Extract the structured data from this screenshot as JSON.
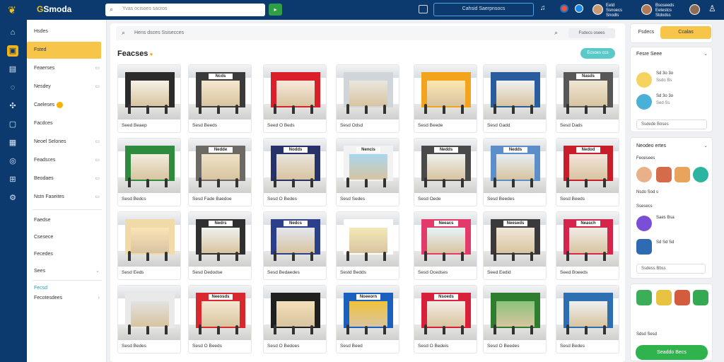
{
  "colors": {
    "navy": "#0d3a6e",
    "accent_yellow": "#f7c54a",
    "green": "#2fb34d",
    "teal": "#5cc9c9"
  },
  "topbar": {
    "logo_icon": "leaf-logo-icon",
    "brand": "Smoda",
    "search_placeholder": "Yvas ocisoes sacros",
    "go_icon": "arrow-right-icon",
    "calendar_icon": "calendar-icon",
    "center_button": "Cahsid Saerpnsocs",
    "bell_icon": "bell-icon",
    "user1": {
      "line1": "Eetd",
      "line2": "Ssnoecs",
      "line3": "Snodls"
    },
    "user2": {
      "line1": "Bsoseeds",
      "line2": "Eetestcs",
      "line3": "Stdodss"
    },
    "profile_icon": "person-icon"
  },
  "rail": [
    "home-icon",
    "store-icon",
    "grid-icon",
    "chat-icon",
    "share-icon",
    "box-icon",
    "calendar-icon",
    "tag-icon",
    "gift-icon",
    "settings-icon"
  ],
  "sidebar": {
    "items": [
      {
        "label": "Hsdes",
        "right": ""
      },
      {
        "label": "Fsted",
        "right": ""
      },
      {
        "label": "Feaerses",
        "right": "▭"
      },
      {
        "label": "Nesdey",
        "right": "▭"
      },
      {
        "label": "Caeleses",
        "right": "",
        "badge": true
      },
      {
        "label": "Facdces",
        "right": ""
      },
      {
        "label": "Neoel Selones",
        "right": "▭"
      },
      {
        "label": "Feadsces",
        "right": "▭"
      },
      {
        "label": "Beodaes",
        "right": "▭"
      },
      {
        "label": "Nstn Faseites",
        "right": "▭"
      }
    ],
    "lower": [
      {
        "label": "Faedse",
        "right": ""
      },
      {
        "label": "Csesece",
        "right": ""
      },
      {
        "label": "Fecedes",
        "right": ""
      },
      {
        "label": "Sees",
        "right": "⌄"
      }
    ],
    "bottom": [
      {
        "label": "Fecsd",
        "right": ""
      },
      {
        "label": "Fecotesdees",
        "right": "›"
      }
    ]
  },
  "main": {
    "search_placeholder": "Hens dsces  Ssisecces",
    "search_icon": "search-icon",
    "filter_pill": "Fsdecs osees",
    "title": "Feacses",
    "title_button": "Ecsoes ccs",
    "cards": [
      {
        "caption": "Seed Beaep",
        "sign": "",
        "store": "#2b2b2b",
        "win": "#f7f1e6"
      },
      {
        "caption": "Sesd Beeds",
        "sign": "Ncds",
        "store": "#3a3a3a",
        "win": "#f4e7cf"
      },
      {
        "caption": "Seed O Beds",
        "sign": "",
        "store": "#d81f2a",
        "win": "#f7e9dc"
      },
      {
        "caption": "Sesd Odsd",
        "sign": "",
        "store": "#cfd5d9",
        "win": "#e9e7df"
      },
      {
        "caption": "Sesd Beede",
        "sign": "",
        "store": "#f2a41c",
        "win": "#fbe7b0"
      },
      {
        "caption": "Sesd Gadd",
        "sign": "",
        "store": "#2a5d9e",
        "win": "#eef0f1"
      },
      {
        "caption": "Sesd Dads",
        "sign": "Nasds",
        "store": "#575757",
        "win": "#efe5d3"
      },
      {
        "caption": "Sesd Bedcs",
        "sign": "",
        "store": "#2e8b3e",
        "win": "#f1ecdd"
      },
      {
        "caption": "Sesd Fade Baedoe",
        "sign": "Nedde",
        "store": "#6d6a66",
        "win": "#efe2c7"
      },
      {
        "caption": "Sesd O Bedes",
        "sign": "Nodds",
        "store": "#27326a",
        "win": "#e9e4dc"
      },
      {
        "caption": "Sesd Sedes",
        "sign": "Nencis",
        "store": "#f2f2f2",
        "win": "#a9d7ee"
      },
      {
        "caption": "Sesd Oede",
        "sign": "Nedds",
        "store": "#4a4a4a",
        "win": "#eef0ee"
      },
      {
        "caption": "Sesd Beedes",
        "sign": "Nedds",
        "store": "#5c8fc9",
        "win": "#e6edf3"
      },
      {
        "caption": "Sesd Beeds",
        "sign": "Nedod",
        "store": "#c81e2a",
        "win": "#f3e4dd"
      },
      {
        "caption": "Sesd Eeds",
        "sign": "",
        "store": "#f2d9a8",
        "win": "#fbe3b8"
      },
      {
        "caption": "Sesd Dedodse",
        "sign": "Nedrs",
        "store": "#2f2f2f",
        "win": "#eef1ee"
      },
      {
        "caption": "Sesd Bedaedes",
        "sign": "Nedcs",
        "store": "#2b3f8a",
        "win": "#e3e6ee"
      },
      {
        "caption": "Sestd Bedds",
        "sign": "",
        "store": "#ffffff",
        "win": "#f3e9b8"
      },
      {
        "caption": "Sesd Ocedses",
        "sign": "Neeacs",
        "store": "#e23b6b",
        "win": "#e6f4f8"
      },
      {
        "caption": "Seed Eedid",
        "sign": "Neeseds",
        "store": "#3a3a3a",
        "win": "#f0e6d8"
      },
      {
        "caption": "Seed Boeeds",
        "sign": "Neasch",
        "store": "#d5254a",
        "win": "#f0ebe6"
      },
      {
        "caption": "Sesd Bedes",
        "sign": "",
        "store": "#e9e9e9",
        "win": "#e2e2e0"
      },
      {
        "caption": "Sesd O Beeds",
        "sign": "Neeosds",
        "store": "#d8272d",
        "win": "#f5e8d2"
      },
      {
        "caption": "Sesd O Bedoes",
        "sign": "",
        "store": "#202020",
        "win": "#f3e1b9"
      },
      {
        "caption": "Sesd Beed",
        "sign": "Noeeorn",
        "store": "#1b5fbf",
        "win": "#f1c23a"
      },
      {
        "caption": "Sesd O Bedeis",
        "sign": "Nsoeds",
        "store": "#d9203a",
        "win": "#f4ede6"
      },
      {
        "caption": "Sesd O Beedes",
        "sign": "",
        "store": "#2f7d2f",
        "win": "#8ac47a"
      },
      {
        "caption": "Sesd Bedes",
        "sign": "",
        "store": "#2d6fb0",
        "win": "#eef0f0"
      }
    ]
  },
  "right": {
    "tab1": "Fsdecs",
    "tab2": "Ccalas",
    "panel1": {
      "title": "Fesre Seee",
      "row1": "Sd 3o 3o",
      "row2": "Ssdo Bs",
      "row3": "Sd 3o 3o",
      "row4": "Sed Ss",
      "field": "Ssdede Boses"
    },
    "panel2": {
      "title": "Neodeo ertes",
      "sub1": "Feoesees",
      "sub2": "Nsdo Sod s",
      "sub3": "Ssesecs",
      "row1": "Saes Bsa",
      "row2": "Sd Sd Sd",
      "field": "Ssdess Bbss"
    },
    "panel3": {
      "row": "Sdsd Sesd"
    },
    "cta": "Seaddo Becs"
  }
}
